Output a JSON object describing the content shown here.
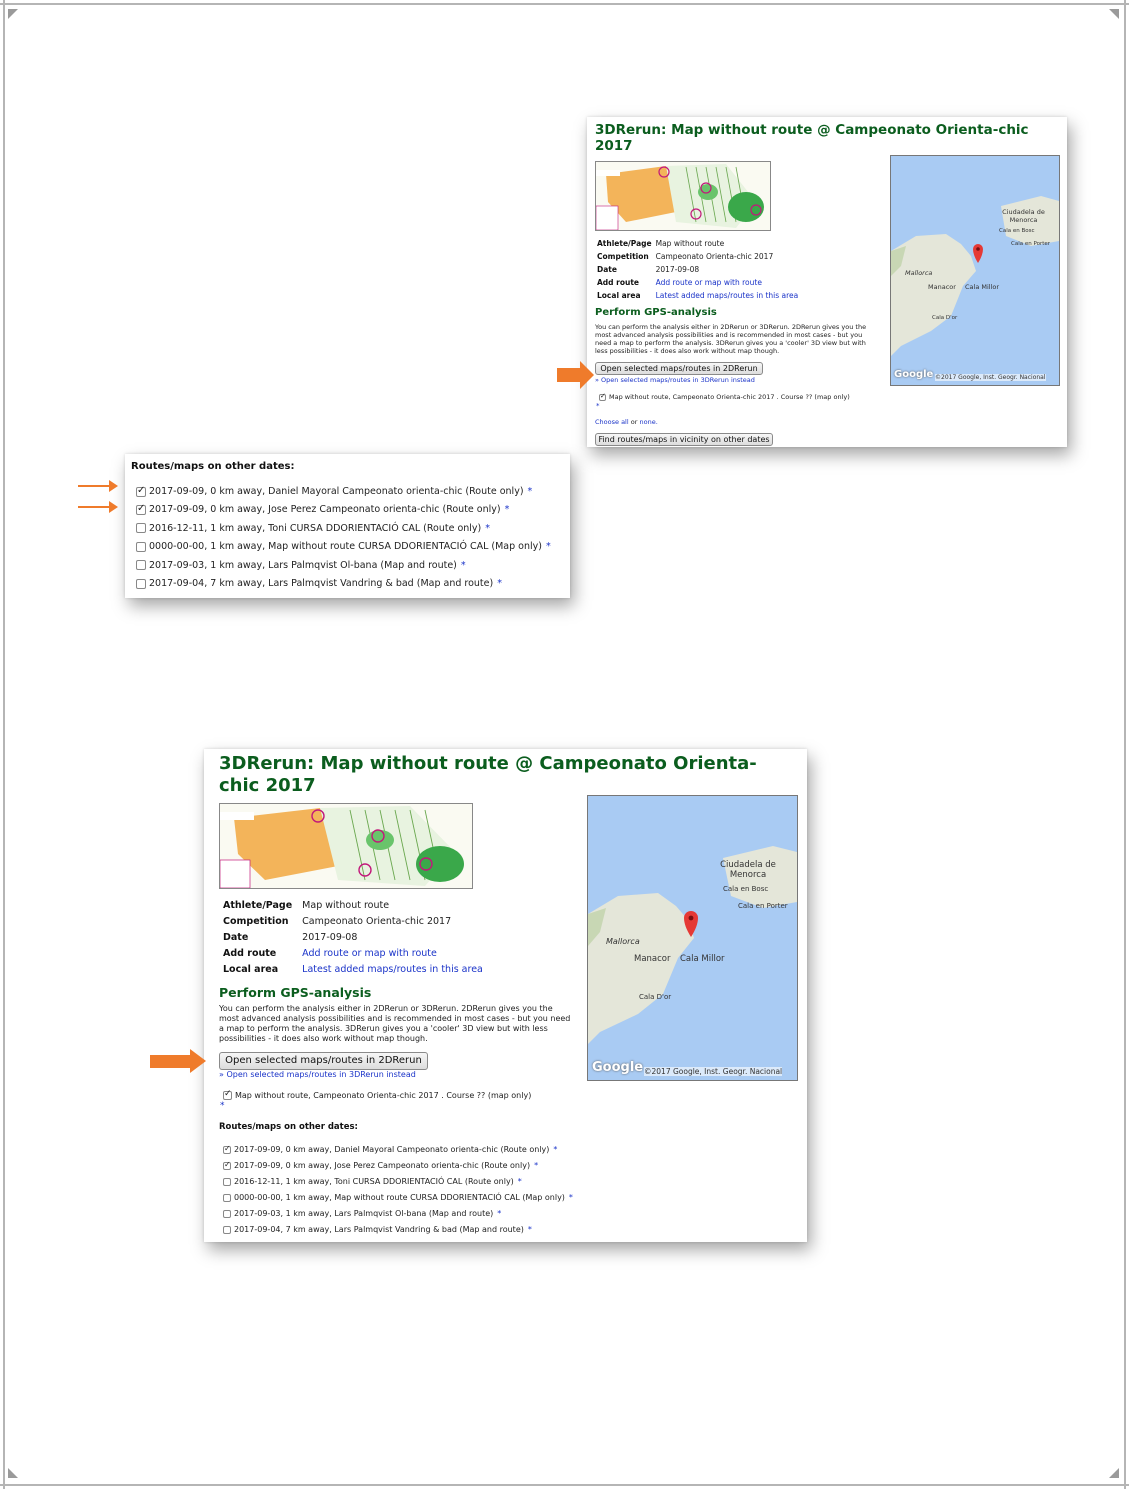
{
  "top_panel": {
    "title": "3DRerun: Map without route @ Campeonato Orienta-chic 2017",
    "info": [
      {
        "key": "Athlete/Page",
        "value": "Map without route",
        "is_link": false
      },
      {
        "key": "Competition",
        "value": "Campeonato Orienta-chic 2017",
        "is_link": false
      },
      {
        "key": "Date",
        "value": "2017-09-08",
        "is_link": false
      },
      {
        "key": "Add route",
        "value": "Add route or map with route",
        "is_link": true
      },
      {
        "key": "Local area",
        "value": "Latest added maps/routes in this area",
        "is_link": true
      }
    ],
    "gps_heading": "Perform GPS-analysis",
    "gps_text": "You can perform the analysis either in 2DRerun or 3DRerun. 2DRerun gives you the most advanced analysis possibilities and is recommended in most cases - but you need a map to perform the analysis. 3DRerun gives you a 'cooler' 3D view but with less possibilities - it does also work without map though.",
    "open_2d_button": "Open selected maps/routes in 2DRerun",
    "open_3d_link": "» Open selected maps/routes in 3DRerun instead",
    "map_checkbox_label": "Map without route, Campeonato Orienta-chic 2017 . Course ?? (map only)",
    "star": "*",
    "choose_all": "Choose all",
    "choose_or": "or",
    "choose_none": "none.",
    "find_button": "Find routes/maps in vicinity on other dates"
  },
  "map_labels": {
    "ciudadela": "Ciudadela de Menorca",
    "cala_bosc": "Cala en Bosc",
    "cala_porter": "Cala en Porter",
    "mallorca": "Mallorca",
    "manacor": "Manacor",
    "cala_millor": "Cala Millor",
    "cala_dor": "Cala D'or",
    "google": "Google",
    "attribution": "©2017 Google, Inst. Geogr. Nacional"
  },
  "routes_panel": {
    "heading": "Routes/maps on other dates:",
    "items": [
      {
        "label": "2017-09-09, 0 km away, Daniel Mayoral Campeonato orienta-chic (Route only)",
        "checked": true
      },
      {
        "label": "2017-09-09, 0 km away, Jose Perez Campeonato orienta-chic (Route only)",
        "checked": true
      },
      {
        "label": "2016-12-11, 1 km away, Toni CURSA DDORIENTACIÓ CAL (Route only)",
        "checked": false
      },
      {
        "label": "0000-00-00, 1 km away, Map without route CURSA DDORIENTACIÓ CAL (Map only)",
        "checked": false
      },
      {
        "label": "2017-09-03, 1 km away, Lars Palmqvist Ol-bana (Map and route)",
        "checked": false
      },
      {
        "label": "2017-09-04, 7 km away, Lars Palmqvist Vandring & bad (Map and route)",
        "checked": false
      }
    ]
  },
  "bottom_panel": {
    "title": "3DRerun: Map without route @ Campeonato Orienta-chic 2017"
  },
  "colors": {
    "accent_arrow": "#ef7b2b",
    "heading_green": "#0b5d1e",
    "link_blue": "#1a33c8",
    "sea": "#a9cbf3"
  }
}
